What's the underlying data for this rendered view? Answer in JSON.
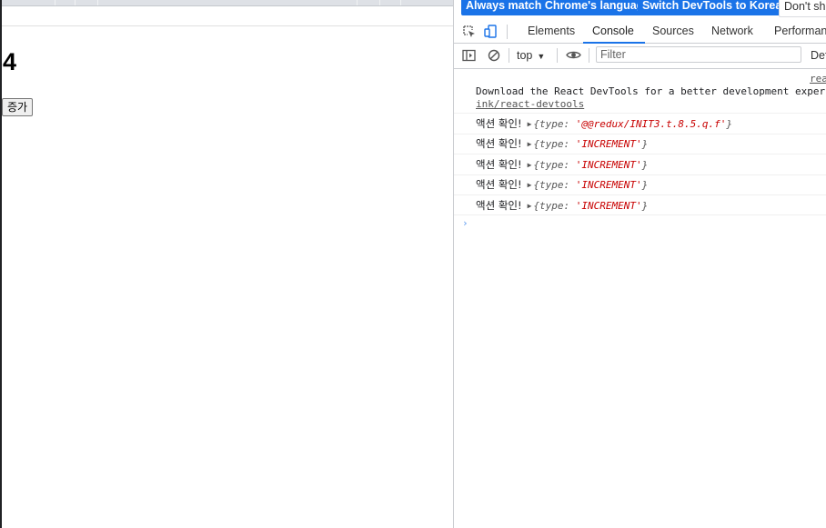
{
  "page": {
    "counter_value": "4",
    "increment_button_label": "증가"
  },
  "devtools": {
    "infobar": {
      "match_language_label": "Always match Chrome's language",
      "switch_korean_label": "Switch DevTools to Korean",
      "dont_show_label": "Don't sh"
    },
    "tabs": [
      {
        "label": "Elements",
        "active": false
      },
      {
        "label": "Console",
        "active": true
      },
      {
        "label": "Sources",
        "active": false
      },
      {
        "label": "Network",
        "active": false
      },
      {
        "label": "Performanc",
        "active": false
      }
    ],
    "toolbar": {
      "context": "top",
      "filter_placeholder": "Filter",
      "levels_label": "Def"
    },
    "console": {
      "source_link": "rea",
      "devtools_message_line1": "Download the React DevTools for a better development experi",
      "devtools_message_link": "ink/react-devtools",
      "logs": [
        {
          "text": "액션 확인!",
          "key": "type",
          "value": "'@@redux/INIT3.t.8.5.q.f'"
        },
        {
          "text": "액션 확인!",
          "key": "type",
          "value": "'INCREMENT'"
        },
        {
          "text": "액션 확인!",
          "key": "type",
          "value": "'INCREMENT'"
        },
        {
          "text": "액션 확인!",
          "key": "type",
          "value": "'INCREMENT'"
        },
        {
          "text": "액션 확인!",
          "key": "type",
          "value": "'INCREMENT'"
        }
      ],
      "prompt_symbol": "›"
    }
  },
  "colors": {
    "accent": "#1a73e8",
    "string_value": "#c80000"
  }
}
